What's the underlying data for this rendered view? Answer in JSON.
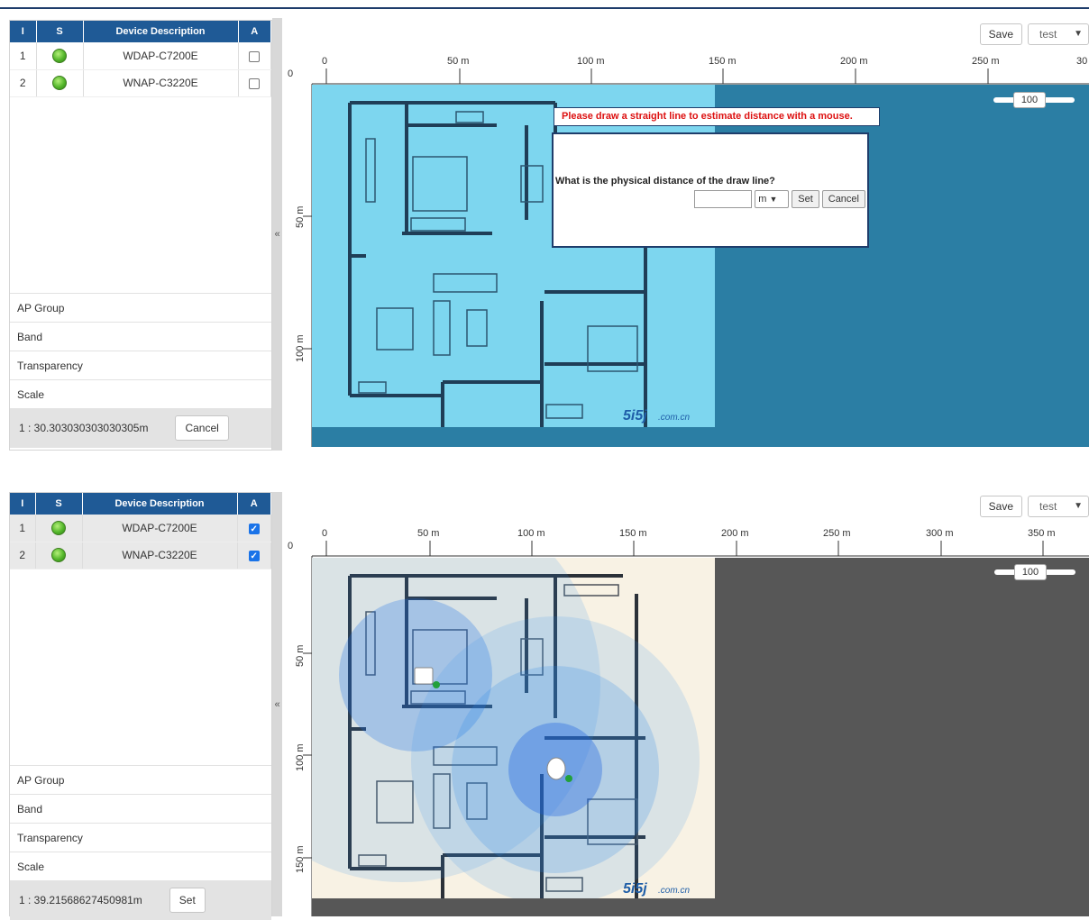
{
  "panel1": {
    "table": {
      "headers": [
        "I",
        "S",
        "Device Description",
        "A"
      ],
      "rows": [
        {
          "index": "1",
          "description": "WDAP-C7200E",
          "checked": false
        },
        {
          "index": "2",
          "description": "WNAP-C3220E",
          "checked": false
        }
      ]
    },
    "options": [
      "AP Group",
      "Band",
      "Transparency",
      "Scale"
    ],
    "scale_value": "1 : 30.303030303030305m",
    "scale_button": "Cancel",
    "collapse_glyph": "«",
    "save_label": "Save",
    "select_value": "test",
    "ruler_x": [
      "0",
      "50 m",
      "100 m",
      "150 m",
      "200 m",
      "250 m",
      "30"
    ],
    "ruler_y": [
      "0",
      "50 m",
      "100 m"
    ],
    "slider_value": "100",
    "hint": "Please draw a straight line to estimate distance with a mouse.",
    "dialog": {
      "question": "What is the physical distance of the draw line?",
      "unit": "m",
      "set_label": "Set",
      "cancel_label": "Cancel"
    },
    "colors": {
      "canvas_bg": "#2b7ea4",
      "plan_bg": "#7dd6ef",
      "header_bg": "#1f5a96",
      "hint_text": "#d11111"
    }
  },
  "panel2": {
    "table": {
      "headers": [
        "I",
        "S",
        "Device Description",
        "A"
      ],
      "rows": [
        {
          "index": "1",
          "description": "WDAP-C7200E",
          "checked": true
        },
        {
          "index": "2",
          "description": "WNAP-C3220E",
          "checked": true
        }
      ]
    },
    "options": [
      "AP Group",
      "Band",
      "Transparency",
      "Scale"
    ],
    "scale_value": "1 : 39.21568627450981m",
    "scale_button": "Set",
    "collapse_glyph": "«",
    "save_label": "Save",
    "select_value": "test",
    "ruler_x": [
      "0",
      "50 m",
      "100 m",
      "150 m",
      "200 m",
      "250 m",
      "300 m",
      "350 m"
    ],
    "ruler_y": [
      "0",
      "50 m",
      "100 m",
      "150 m"
    ],
    "slider_value": "100",
    "colors": {
      "canvas_bg": "#575757",
      "plan_bg": "#f8f2e4",
      "coverage": "#1e78e6"
    }
  },
  "watermark": "www.5i5j.com.cn",
  "icons": [
    "status-green-dot-icon",
    "checkbox-icon",
    "collapse-chevron-icon",
    "dropdown-caret-icon",
    "access-point-icon"
  ]
}
